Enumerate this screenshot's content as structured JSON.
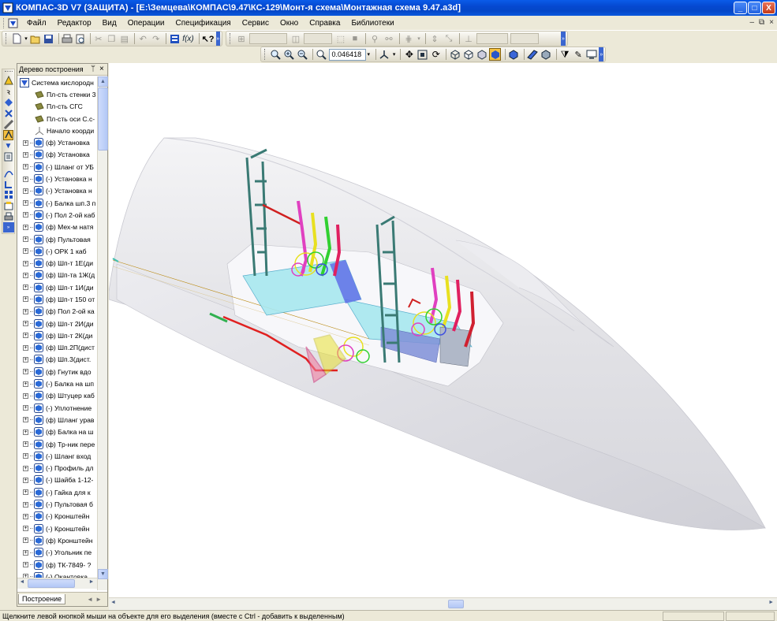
{
  "window": {
    "title": "КОМПАС-3D V7 (ЗАЩИТА) - [E:\\Земцева\\КОМПАС\\9.47\\КС-129\\Монт-я схема\\Монтажная схема 9.47.a3d]",
    "minimize": "_",
    "maximize": "□",
    "close": "X"
  },
  "menubar": {
    "items": [
      "Файл",
      "Редактор",
      "Вид",
      "Операции",
      "Спецификация",
      "Сервис",
      "Окно",
      "Справка",
      "Библиотеки"
    ],
    "doc_controls": [
      "–",
      "⧉",
      "×"
    ]
  },
  "toolbar": {
    "fx_label": "f(x)",
    "zoom_value": "0.046418"
  },
  "tree_panel": {
    "header": "Дерево построения",
    "pin": "ᛘ",
    "close": "×",
    "tab_label": "Построение",
    "items": [
      {
        "label": "Система кислородн",
        "kind": "root",
        "expand": ""
      },
      {
        "label": "Пл-сть стенки 3",
        "kind": "plane",
        "expand": ""
      },
      {
        "label": "Пл-сть СГС",
        "kind": "plane",
        "expand": ""
      },
      {
        "label": "Пл-сть оси С.с-",
        "kind": "plane",
        "expand": ""
      },
      {
        "label": "Начало коорди",
        "kind": "origin",
        "expand": ""
      },
      {
        "label": "(ф) Установка",
        "kind": "part",
        "expand": "+"
      },
      {
        "label": "(ф) Установка",
        "kind": "part",
        "expand": "+"
      },
      {
        "label": "(-) Шланг от УБ",
        "kind": "part",
        "expand": "+"
      },
      {
        "label": "(-) Установка н",
        "kind": "part",
        "expand": "+"
      },
      {
        "label": "(-) Установка н",
        "kind": "part",
        "expand": "+"
      },
      {
        "label": "(-) Балка шп.3 п",
        "kind": "part",
        "expand": "+"
      },
      {
        "label": "(-) Пол 2-ой каб",
        "kind": "part",
        "expand": "+"
      },
      {
        "label": "(ф) Мех-м натя",
        "kind": "part",
        "expand": "+"
      },
      {
        "label": "(ф) Пультовая",
        "kind": "part",
        "expand": "+"
      },
      {
        "label": "(-) ОРК 1 каб",
        "kind": "part",
        "expand": "+"
      },
      {
        "label": "(ф) Шп-т 1Е(ди",
        "kind": "part",
        "expand": "+"
      },
      {
        "label": "(ф) Шп-та 1Ж(д",
        "kind": "part",
        "expand": "+"
      },
      {
        "label": "(ф) Шп-т 1И(ди",
        "kind": "part",
        "expand": "+"
      },
      {
        "label": "(ф) Шп-т 150 от",
        "kind": "part",
        "expand": "+"
      },
      {
        "label": "(ф) Пол 2-ой ка",
        "kind": "part",
        "expand": "+"
      },
      {
        "label": "(ф) Шп-т 2И(ди",
        "kind": "part",
        "expand": "+"
      },
      {
        "label": "(ф) Шп-т 2К(ди",
        "kind": "part",
        "expand": "+"
      },
      {
        "label": "(ф) Шп.2П(дист",
        "kind": "part",
        "expand": "+"
      },
      {
        "label": "(ф) Шп.3(дист.",
        "kind": "part",
        "expand": "+"
      },
      {
        "label": "(ф) Гнутик вдо",
        "kind": "part",
        "expand": "+"
      },
      {
        "label": "(-) Балка на шп",
        "kind": "part",
        "expand": "+"
      },
      {
        "label": "(ф) Штуцер каб",
        "kind": "part",
        "expand": "+"
      },
      {
        "label": "(-) Уплотнение",
        "kind": "part",
        "expand": "+"
      },
      {
        "label": "(ф) Шланг урав",
        "kind": "part",
        "expand": "+"
      },
      {
        "label": "(ф) Балка на ш",
        "kind": "part",
        "expand": "+"
      },
      {
        "label": "(ф) Тр-ник пере",
        "kind": "part",
        "expand": "+"
      },
      {
        "label": "(-) Шланг вход",
        "kind": "part",
        "expand": "+"
      },
      {
        "label": "(-) Профиль дл",
        "kind": "part",
        "expand": "+"
      },
      {
        "label": "(-) Шайба 1-12-",
        "kind": "part",
        "expand": "+"
      },
      {
        "label": "(-) Гайка для к",
        "kind": "part",
        "expand": "+"
      },
      {
        "label": "(-) Пультовая б",
        "kind": "part",
        "expand": "+"
      },
      {
        "label": "(-) Кронштейн",
        "kind": "part",
        "expand": "+"
      },
      {
        "label": "(-) Кронштейн",
        "kind": "part",
        "expand": "+"
      },
      {
        "label": "(ф) Кронштейн",
        "kind": "part",
        "expand": "+"
      },
      {
        "label": "(-) Угольник пе",
        "kind": "part",
        "expand": "+"
      },
      {
        "label": "(ф) ТК-7849- ?",
        "kind": "part",
        "expand": "+"
      },
      {
        "label": "(-) Окантовка",
        "kind": "part",
        "expand": "+"
      }
    ]
  },
  "status": {
    "text": "Щелкните левой кнопкой мыши на объекте для его выделения (вместе с Ctrl - добавить к выделенным)"
  },
  "colors": {
    "titlebar": "#0548d0",
    "chrome": "#ece9d8",
    "fuselage": "#e4e4e8",
    "canopy_frame": "#4a8a84",
    "pipe_red": "#e02020",
    "part_magenta": "#e040c0",
    "part_yellow": "#e8e020",
    "part_green": "#30d030",
    "floor_cyan": "#a8e8f0",
    "panel_blue": "#6070e8"
  }
}
